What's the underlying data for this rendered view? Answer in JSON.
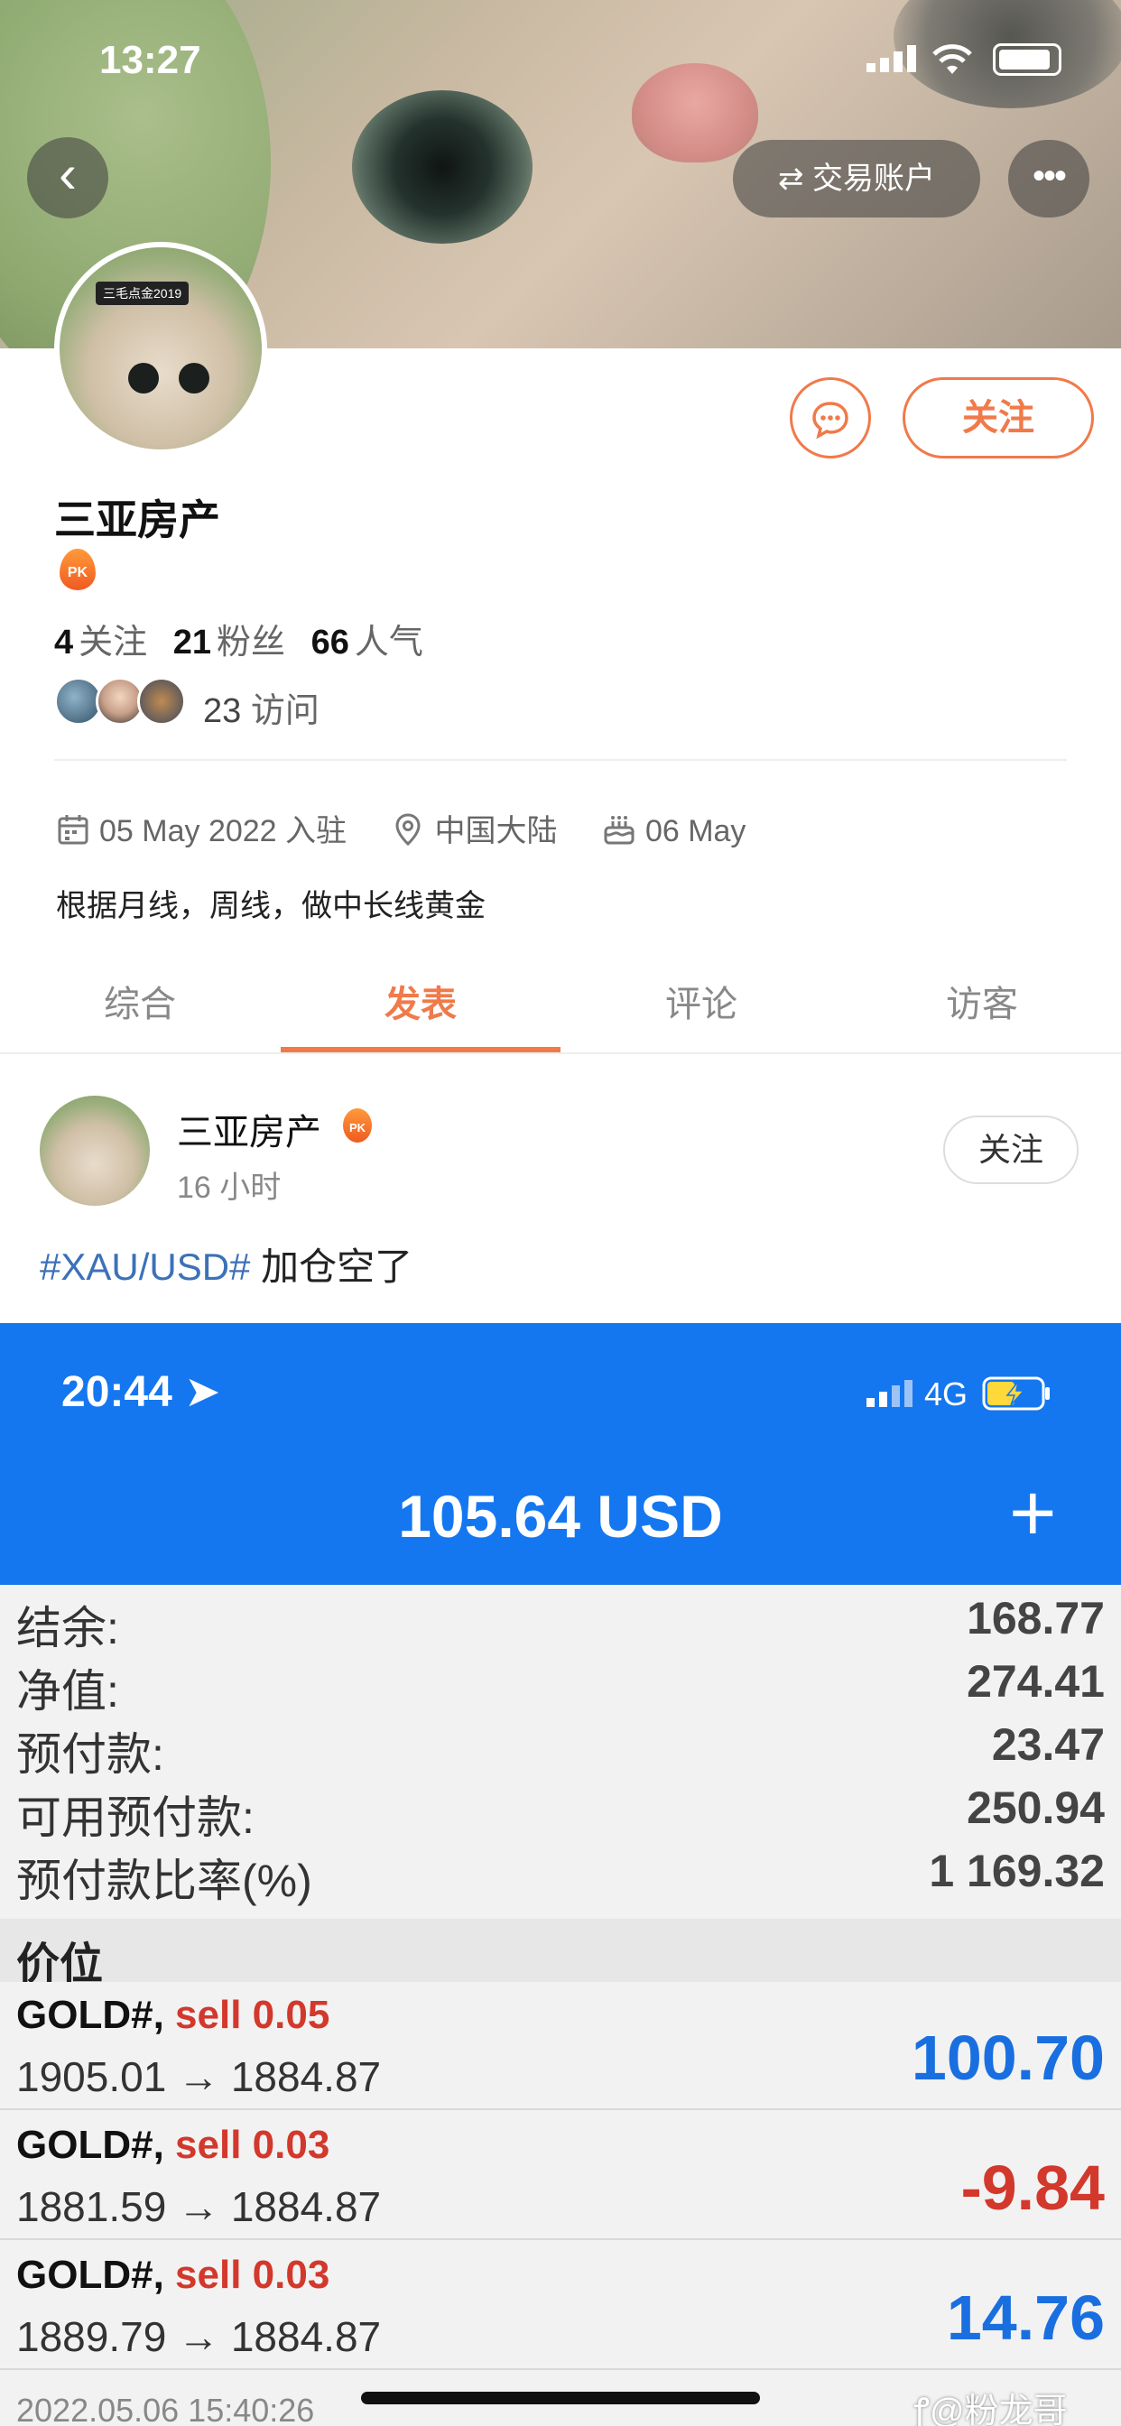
{
  "status_bar": {
    "time": "13:27"
  },
  "header": {
    "account_button": "⇄ 交易账户",
    "more_button": "•••",
    "back_icon": "‹"
  },
  "profile": {
    "avatar_tag": "三毛点金2019",
    "name": "三亚房产",
    "badge": "PK",
    "stats": {
      "following": "4",
      "following_label": "关注",
      "fans": "21",
      "fans_label": "粉丝",
      "popularity": "66",
      "popularity_label": "人气"
    },
    "visits": "23",
    "visits_label": "访问",
    "joined": "05 May 2022 入驻",
    "location": "中国大陆",
    "birthday": "06 May",
    "bio": "根据月线，周线，做中长线黄金",
    "follow_button": "关注"
  },
  "tabs": [
    "综合",
    "发表",
    "评论",
    "访客"
  ],
  "post": {
    "author": "三亚房产",
    "badge": "PK",
    "time": "16 小时",
    "follow_button": "关注",
    "hashtag": "#XAU/USD#",
    "text": " 加仓空了"
  },
  "trade_screenshot": {
    "time": "20:44 ➤",
    "network": "4G",
    "amount": "105.64 USD",
    "plus": "+",
    "rows": [
      {
        "label": "结余:",
        "value": "168.77"
      },
      {
        "label": "净值:",
        "value": "274.41"
      },
      {
        "label": "预付款:",
        "value": "23.47"
      },
      {
        "label": "可用预付款:",
        "value": "250.94"
      },
      {
        "label": "预付款比率(%)",
        "value": "1 169.32"
      }
    ],
    "section_title": "价位",
    "positions": [
      {
        "symbol": "GOLD#,",
        "side": "sell 0.05",
        "prices": "1905.01 → 1884.87",
        "pl": "100.70"
      },
      {
        "symbol": "GOLD#,",
        "side": "sell 0.03",
        "prices": "1881.59 → 1884.87",
        "pl": "-9.84"
      },
      {
        "symbol": "GOLD#,",
        "side": "sell 0.03",
        "prices": "1889.79 → 1884.87",
        "pl": "14.76"
      }
    ],
    "footer": "2022.05.06 15:40:26"
  },
  "watermark": "ꝭ@粉龙哥"
}
